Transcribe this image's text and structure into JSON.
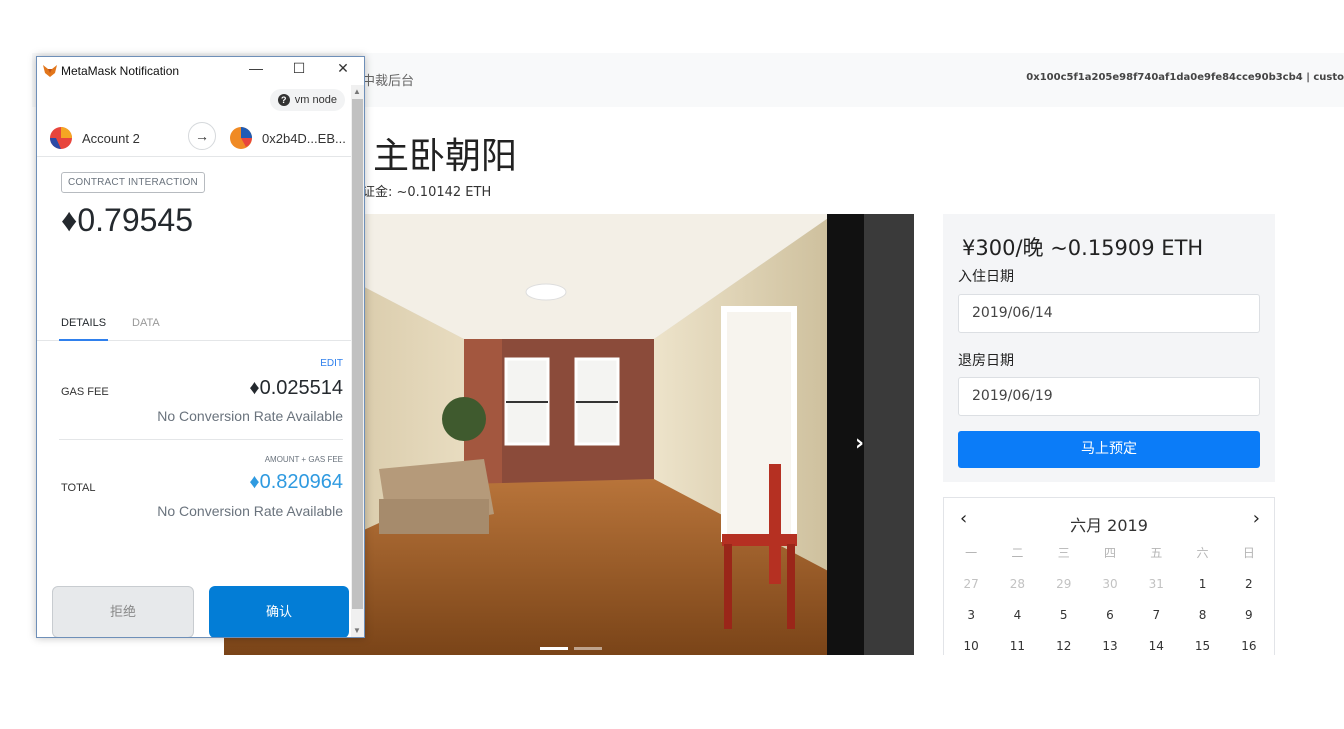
{
  "page": {
    "brand": "中裁后台",
    "account_text": "0x100c5f1a205e98f740af1da0e9fe84cce90b3cb4 | custo",
    "room_title": "主卧朝阳",
    "deposit": "证金: ~0.10142 ETH",
    "carousel_next": "›",
    "booking": {
      "price": "¥300/晚 ~0.15909 ETH",
      "checkin_label": "入住日期",
      "checkin_value": "2019/06/14",
      "checkout_label": "退房日期",
      "checkout_value": "2019/06/19",
      "book_button": "马上预定"
    },
    "calendar": {
      "prev": "‹",
      "next": "›",
      "title": "六月 2019",
      "weekdays": [
        "一",
        "二",
        "三",
        "四",
        "五",
        "六",
        "日"
      ],
      "rows": [
        [
          "27",
          "28",
          "29",
          "30",
          "31",
          "1",
          "2"
        ],
        [
          "3",
          "4",
          "5",
          "6",
          "7",
          "8",
          "9"
        ],
        [
          "10",
          "11",
          "12",
          "13",
          "14",
          "15",
          "16"
        ]
      ]
    }
  },
  "metamask": {
    "window_title": "MetaMask Notification",
    "minimize": "—",
    "maximize": "☐",
    "close": "✕",
    "network": "vm node",
    "from_account": "Account 2",
    "to_account": "0x2b4D...EB...",
    "arrow": "→",
    "contract_tag": "CONTRACT INTERACTION",
    "amount": "♦0.79545",
    "tabs": [
      "DETAILS",
      "DATA"
    ],
    "edit": "EDIT",
    "gas_fee_label": "GAS FEE",
    "gas_fee_value": "♦0.025514",
    "gas_fee_sub": "No Conversion Rate Available",
    "amount_gas_caption": "AMOUNT + GAS FEE",
    "total_label": "TOTAL",
    "total_value": "♦0.820964",
    "total_sub": "No Conversion Rate Available",
    "reject_button": "拒绝",
    "confirm_button": "确认",
    "colors": {
      "accent": "#037dd6",
      "link": "#2f80ed",
      "total": "#2f9ae0"
    }
  }
}
